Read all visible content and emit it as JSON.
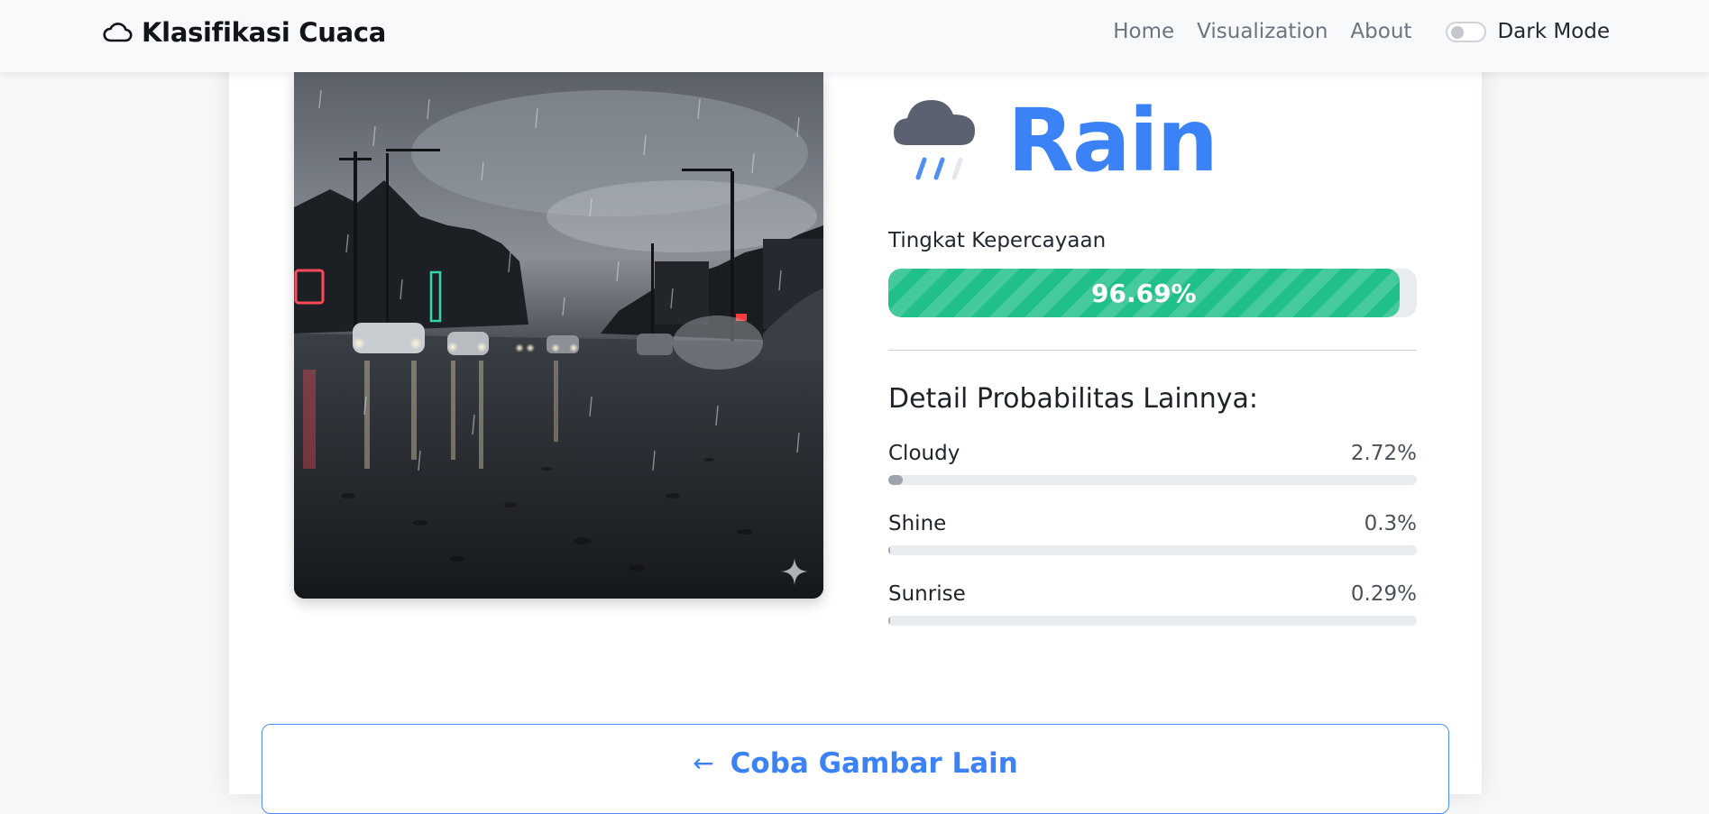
{
  "navbar": {
    "brand_icon": "cloud-icon",
    "brand": "Klasifikasi Cuaca",
    "links": [
      "Home",
      "Visualization",
      "About"
    ],
    "dark_mode_label": "Dark Mode",
    "dark_mode_on": false
  },
  "image": {
    "description_icon": "sparkle-icon"
  },
  "result": {
    "icon": "rain-cloud-icon",
    "label": "Rain",
    "color": "#3b82f6",
    "confidence_label": "Tingkat Kepercayaan",
    "confidence_text": "96.69%",
    "confidence": 96.69,
    "confidence_color": "#20c088"
  },
  "details": {
    "title": "Detail Probabilitas Lainnya:",
    "items": [
      {
        "name": "Cloudy",
        "value_text": "2.72%",
        "value": 2.72
      },
      {
        "name": "Shine",
        "value_text": "0.3%",
        "value": 0.3
      },
      {
        "name": "Sunrise",
        "value_text": "0.29%",
        "value": 0.29
      }
    ]
  },
  "retry_button": {
    "icon": "arrow-left-icon",
    "label": "Coba Gambar Lain"
  }
}
